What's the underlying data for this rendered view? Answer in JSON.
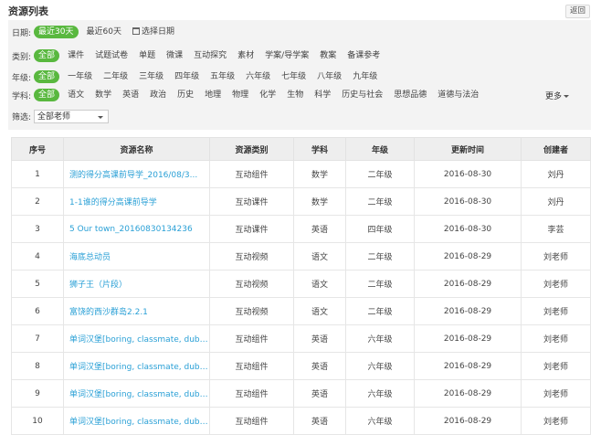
{
  "header": {
    "title": "资源列表",
    "back_label": "返回"
  },
  "filters": {
    "date": {
      "label": "日期:",
      "options": [
        "最近30天",
        "最近60天"
      ],
      "active": 0,
      "pick_label": "选择日期"
    },
    "category": {
      "label": "类别:",
      "options": [
        "全部",
        "课件",
        "试题试卷",
        "单题",
        "微课",
        "互动探究",
        "素材",
        "学案/导学案",
        "教案",
        "备课参考"
      ],
      "active": 0
    },
    "grade": {
      "label": "年级:",
      "options": [
        "全部",
        "一年级",
        "二年级",
        "三年级",
        "四年级",
        "五年级",
        "六年级",
        "七年级",
        "八年级",
        "九年级"
      ],
      "active": 0
    },
    "subject": {
      "label": "学科:",
      "options": [
        "全部",
        "语文",
        "数学",
        "英语",
        "政治",
        "历史",
        "地理",
        "物理",
        "化学",
        "生物",
        "科学",
        "历史与社会",
        "思想品德",
        "道德与法治"
      ],
      "active": 0,
      "more_label": "更多"
    },
    "screen": {
      "label": "筛选:",
      "value": "全部老师"
    }
  },
  "table": {
    "columns": [
      "序号",
      "资源名称",
      "资源类别",
      "学科",
      "年级",
      "更新时间",
      "创建者"
    ],
    "rows": [
      [
        "1",
        "测的得分高课前导学_2016/08/3...",
        "互动组件",
        "数学",
        "二年级",
        "2016-08-30",
        "刘丹"
      ],
      [
        "2",
        "1-1谁的得分高课前导学",
        "互动课件",
        "数学",
        "二年级",
        "2016-08-30",
        "刘丹"
      ],
      [
        "3",
        "5 Our town_20160830134236",
        "互动课件",
        "英语",
        "四年级",
        "2016-08-30",
        "李芸"
      ],
      [
        "4",
        "海底总动员",
        "互动视频",
        "语文",
        "二年级",
        "2016-08-29",
        "刘老师"
      ],
      [
        "5",
        "狮子王（片段）",
        "互动视频",
        "语文",
        "二年级",
        "2016-08-29",
        "刘老师"
      ],
      [
        "6",
        "富饶的西沙群岛2.2.1",
        "互动视频",
        "语文",
        "二年级",
        "2016-08-29",
        "刘老师"
      ],
      [
        "7",
        "单词汉堡[boring, classmate, dub...]",
        "互动组件",
        "英语",
        "六年级",
        "2016-08-29",
        "刘老师"
      ],
      [
        "8",
        "单词汉堡[boring, classmate, dub...]",
        "互动组件",
        "英语",
        "六年级",
        "2016-08-29",
        "刘老师"
      ],
      [
        "9",
        "单词汉堡[boring, classmate, dub...]",
        "互动组件",
        "英语",
        "六年级",
        "2016-08-29",
        "刘老师"
      ],
      [
        "10",
        "单词汉堡[boring, classmate, dub...]",
        "互动组件",
        "英语",
        "六年级",
        "2016-08-29",
        "刘老师"
      ]
    ]
  },
  "colors": {
    "accent": "#59b83f",
    "link": "#2aa0d6",
    "panel": "#f3f3f3"
  },
  "icons": {
    "calendar": "calendar-icon",
    "dropdown": "chevron-down-icon"
  }
}
